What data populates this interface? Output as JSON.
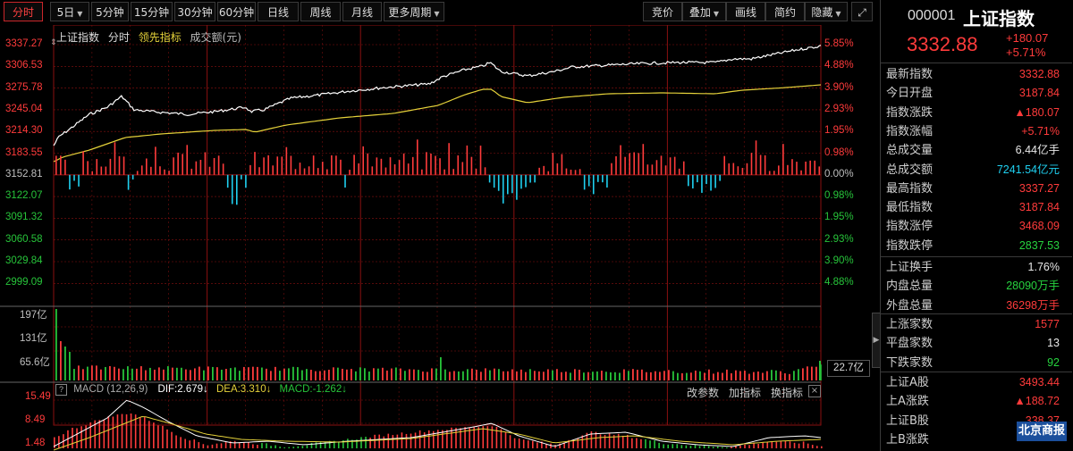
{
  "toolbar": {
    "periods": [
      {
        "label": "分时",
        "selected": true
      },
      {
        "label": "5日",
        "dropdown": true
      },
      {
        "label": "5分钟"
      },
      {
        "label": "15分钟"
      },
      {
        "label": "30分钟"
      },
      {
        "label": "60分钟"
      },
      {
        "label": "日线"
      },
      {
        "label": "周线"
      },
      {
        "label": "月线"
      },
      {
        "label": "更多周期",
        "dropdown": true
      }
    ],
    "right_buttons": [
      {
        "label": "竞价"
      },
      {
        "label": "叠加",
        "dropdown": true
      },
      {
        "label": "画线"
      },
      {
        "label": "简约"
      },
      {
        "label": "隐藏",
        "dropdown": true
      }
    ],
    "expand_icon": "expand-icon"
  },
  "legend": {
    "index_name": "上证指数",
    "mode": "分时",
    "leading": "领先指标",
    "turnover": "成交额(元)"
  },
  "price_axis": {
    "left_labels": [
      "3337.27",
      "3306.53",
      "3275.78",
      "3245.04",
      "3214.30",
      "3183.55",
      "3152.81",
      "3122.07",
      "3091.32",
      "3060.58",
      "3029.84",
      "2999.09"
    ],
    "right_labels": [
      "5.85%",
      "4.88%",
      "3.90%",
      "2.93%",
      "1.95%",
      "0.98%",
      "0.00%",
      "0.98%",
      "1.95%",
      "2.93%",
      "3.90%",
      "4.88%"
    ]
  },
  "volume_axis": {
    "labels": [
      "197亿",
      "131亿",
      "65.6亿"
    ],
    "current": "22.7亿"
  },
  "macd": {
    "help_icon": "?",
    "name": "MACD",
    "params": "(12,26,9)",
    "dif": "DIF:2.679",
    "dea": "DEA:3.310",
    "macd": "MACD:-1.262",
    "buttons": [
      "改参数",
      "加指标",
      "换指标"
    ],
    "y_labels": [
      "15.49",
      "8.49",
      "1.48"
    ]
  },
  "quote": {
    "code": "000001",
    "name": "上证指数",
    "price": "3332.88",
    "change": "+180.07",
    "change_pct": "+5.71%"
  },
  "stats_group1": [
    {
      "label": "最新指数",
      "value": "3332.88",
      "color": "red"
    },
    {
      "label": "今日开盘",
      "value": "3187.84",
      "color": "red"
    },
    {
      "label": "指数涨跌",
      "value": "▲180.07",
      "color": "red"
    },
    {
      "label": "指数涨幅",
      "value": "+5.71%",
      "color": "red"
    },
    {
      "label": "总成交量",
      "value": "6.44亿手",
      "color": "white"
    },
    {
      "label": "总成交额",
      "value": "7241.54亿元",
      "color": "cyan"
    },
    {
      "label": "最高指数",
      "value": "3337.27",
      "color": "red"
    },
    {
      "label": "最低指数",
      "value": "3187.84",
      "color": "red"
    },
    {
      "label": "指数涨停",
      "value": "3468.09",
      "color": "red"
    },
    {
      "label": "指数跌停",
      "value": "2837.53",
      "color": "green"
    }
  ],
  "stats_group2": [
    {
      "label": "上证换手",
      "value": "1.76%",
      "color": "white"
    },
    {
      "label": "内盘总量",
      "value": "28090万手",
      "color": "green"
    },
    {
      "label": "外盘总量",
      "value": "36298万手",
      "color": "red"
    }
  ],
  "stats_group3": [
    {
      "label": "上涨家数",
      "value": "1577",
      "color": "red"
    },
    {
      "label": "平盘家数",
      "value": "13",
      "color": "white"
    },
    {
      "label": "下跌家数",
      "value": "92",
      "color": "green"
    }
  ],
  "stats_group4": [
    {
      "label": "上证A股",
      "value": "3493.44",
      "color": "red"
    },
    {
      "label": "上A涨跌",
      "value": "▲188.72",
      "color": "red"
    },
    {
      "label": "上证B股",
      "value": "338.37",
      "color": "red"
    },
    {
      "label": "上B涨跌",
      "value": "",
      "color": "red"
    }
  ],
  "watermark": "北京商报",
  "colors": {
    "up": "#ff3b3b",
    "down": "#27c43a",
    "cyan": "#1fd0f0",
    "price_line": "#ffffff",
    "avg_line": "#e5d23a",
    "grid": "#8a1010"
  }
}
